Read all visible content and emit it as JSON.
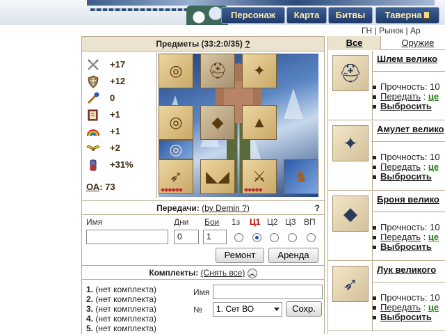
{
  "nav": {
    "tabs": [
      "Персонаж",
      "Карта",
      "Битвы",
      "Таверна"
    ]
  },
  "toplinks": {
    "gn": "ГН",
    "sep": "|",
    "market": "Рынок",
    "more": "Ар"
  },
  "items_section": {
    "title": "Предметы (33:2:0/35)",
    "help": "?"
  },
  "stats": [
    {
      "icon": "sword-icon",
      "value": "+17"
    },
    {
      "icon": "shield-icon",
      "value": "+12"
    },
    {
      "icon": "wand-icon",
      "value": "0"
    },
    {
      "icon": "book-icon",
      "value": "+1"
    },
    {
      "icon": "rainbow-icon",
      "value": "+1"
    },
    {
      "icon": "wings-icon",
      "value": "+2"
    },
    {
      "icon": "potion-icon",
      "value": "+31%"
    }
  ],
  "oa": {
    "label": "ОА",
    "value": "73"
  },
  "transfers": {
    "title": "Передачи:",
    "by": "(by Demin ?)",
    "help": "?",
    "labels": {
      "name": "Имя",
      "days": "Дни",
      "battles": "Бои",
      "t1": "1з",
      "c1": "Ц1",
      "c2": "Ц2",
      "c3": "Ц3",
      "vp": "ВП"
    },
    "days_value": "0",
    "battles_value": "1",
    "repair": "Ремонт",
    "rent": "Аренда"
  },
  "sets": {
    "title": "Комплекты:",
    "remove_all": "(Снять все)",
    "items": [
      {
        "num": "1.",
        "text": "(нет комплекта)"
      },
      {
        "num": "2.",
        "text": "(нет комплекта)"
      },
      {
        "num": "3.",
        "text": "(нет комплекта)"
      },
      {
        "num": "4.",
        "text": "(нет комплекта)"
      },
      {
        "num": "5.",
        "text": "(нет комплекта)"
      }
    ],
    "name_label": "Имя",
    "num_label": "№",
    "select_value": "1. Сет ВО",
    "save": "Сохр."
  },
  "right_tabs": {
    "all": "Все",
    "weapon": "Оружие"
  },
  "inventory": [
    {
      "title": "Шлем велико",
      "icon": "helmet-icon",
      "durability": "Прочность: 10",
      "transfer": "Передать",
      "colon": ":",
      "price": "це",
      "drop": "Выбросить"
    },
    {
      "title": "Амулет велико",
      "icon": "amulet-icon",
      "durability": "Прочность: 10",
      "transfer": "Передать",
      "colon": ":",
      "price": "це",
      "drop": "Выбросить"
    },
    {
      "title": "Броня велико",
      "icon": "armor-icon",
      "durability": "Прочность: 10",
      "transfer": "Передать",
      "colon": ":",
      "price": "це",
      "drop": "Выбросить"
    },
    {
      "title": "Лук великого",
      "icon": "bow-icon",
      "durability": "Прочность: 10",
      "transfer": "Передать",
      "colon": ":",
      "price": "це",
      "drop": "Выбросить"
    }
  ]
}
